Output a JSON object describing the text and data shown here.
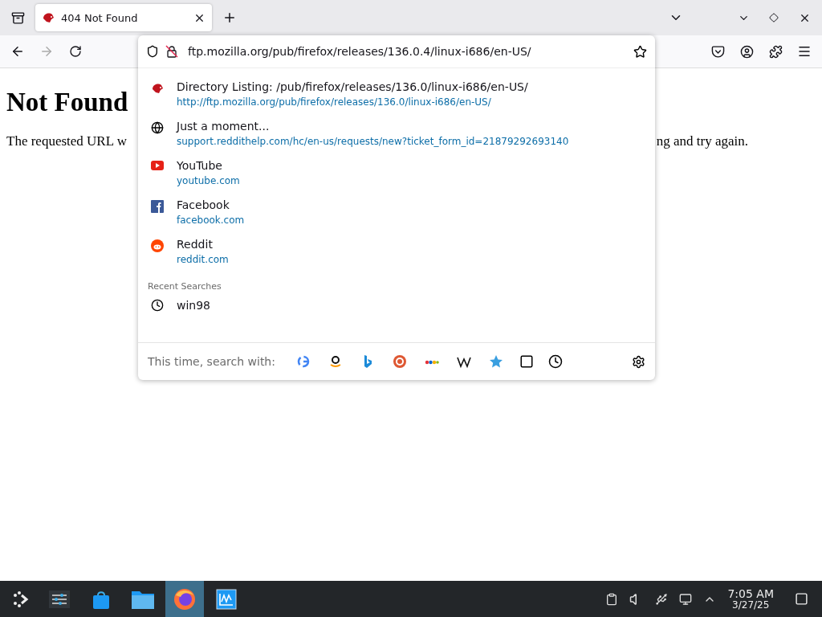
{
  "tab_bar": {
    "tabs": [
      {
        "title": "404 Not Found",
        "selected": true
      }
    ]
  },
  "address_bar": {
    "value": "ftp.mozilla.org/pub/firefox/releases/136.0.4/linux-i686/en-US/"
  },
  "suggestions": [
    {
      "kind": "hedgehog",
      "title": "Directory Listing: /pub/firefox/releases/136.0/linux-i686/en-US/",
      "url": "http://ftp.mozilla.org/pub/firefox/releases/136.0/linux-i686/en-US/"
    },
    {
      "kind": "globe",
      "title": "Just a moment...",
      "url": "support.reddithelp.com/hc/en-us/requests/new?ticket_form_id=21879292693140"
    },
    {
      "kind": "play",
      "title": "YouTube",
      "url": "youtube.com"
    },
    {
      "kind": "fsquare",
      "title": "Facebook",
      "url": "facebook.com"
    },
    {
      "kind": "alien",
      "title": "Reddit",
      "url": "reddit.com"
    }
  ],
  "recent_searches": {
    "heading": "Recent Searches",
    "items": [
      {
        "text": "win98"
      }
    ]
  },
  "search_with": {
    "label": "This time, search with:"
  },
  "page": {
    "heading": "Not Found",
    "paragraph_start": "The requested URL w",
    "paragraph_end": "ng and try again."
  },
  "taskbar": {
    "tasks": [
      {
        "kind": "mixer",
        "selected": false
      },
      {
        "kind": "store",
        "selected": false
      },
      {
        "kind": "folder",
        "selected": false
      },
      {
        "kind": "browser",
        "selected": true
      },
      {
        "kind": "monitor",
        "selected": false
      }
    ],
    "time": "7:05 AM",
    "date": "3/27/25"
  }
}
